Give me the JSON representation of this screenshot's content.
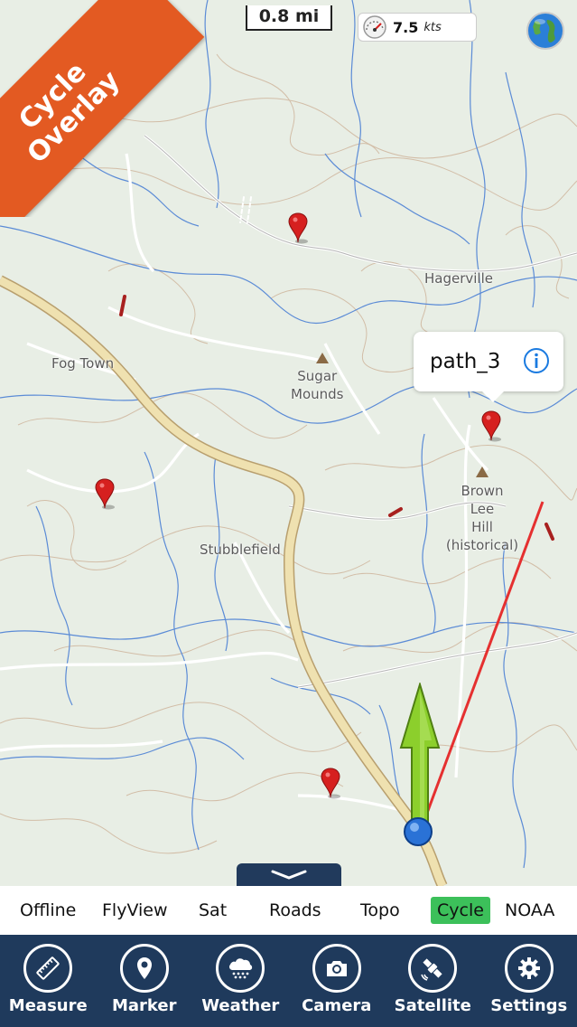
{
  "overlay_badge": {
    "line1": "Cycle",
    "line2": "Overlay"
  },
  "scale_bar": {
    "label": "0.8 mi"
  },
  "speed": {
    "value": "7.5",
    "unit": "kts"
  },
  "callout": {
    "label": "path_3"
  },
  "places": {
    "hagerville": "Hagerville",
    "fog_town": "Fog Town",
    "sugar_mounds_1": "Sugar",
    "sugar_mounds_2": "Mounds",
    "brown_lee_1": "Brown",
    "brown_lee_2": "Lee",
    "brown_lee_3": "Hill",
    "brown_lee_4": "(historical)",
    "stubblefield": "Stubblefield"
  },
  "tabs": [
    {
      "label": "Offline",
      "active": false
    },
    {
      "label": "FlyView",
      "active": false
    },
    {
      "label": "Sat",
      "active": false
    },
    {
      "label": "Roads",
      "active": false
    },
    {
      "label": "Topo",
      "active": false
    },
    {
      "label": "Cycle",
      "active": true
    },
    {
      "label": "NOAA",
      "active": false
    }
  ],
  "toolbar": [
    {
      "label": "Measure",
      "icon": "ruler-icon"
    },
    {
      "label": "Marker",
      "icon": "map-pin-icon"
    },
    {
      "label": "Weather",
      "icon": "cloud-rain-icon"
    },
    {
      "label": "Camera",
      "icon": "camera-icon"
    },
    {
      "label": "Satellite",
      "icon": "satellite-icon"
    },
    {
      "label": "Settings",
      "icon": "gear-icon"
    }
  ],
  "colors": {
    "ribbon": "#e35a22",
    "toolbar_bg": "#1f3a5c",
    "active_tab": "#3cc05a",
    "route_line": "#e53030",
    "pin": "#d6201f",
    "heading_arrow": "#8ccf2c"
  }
}
